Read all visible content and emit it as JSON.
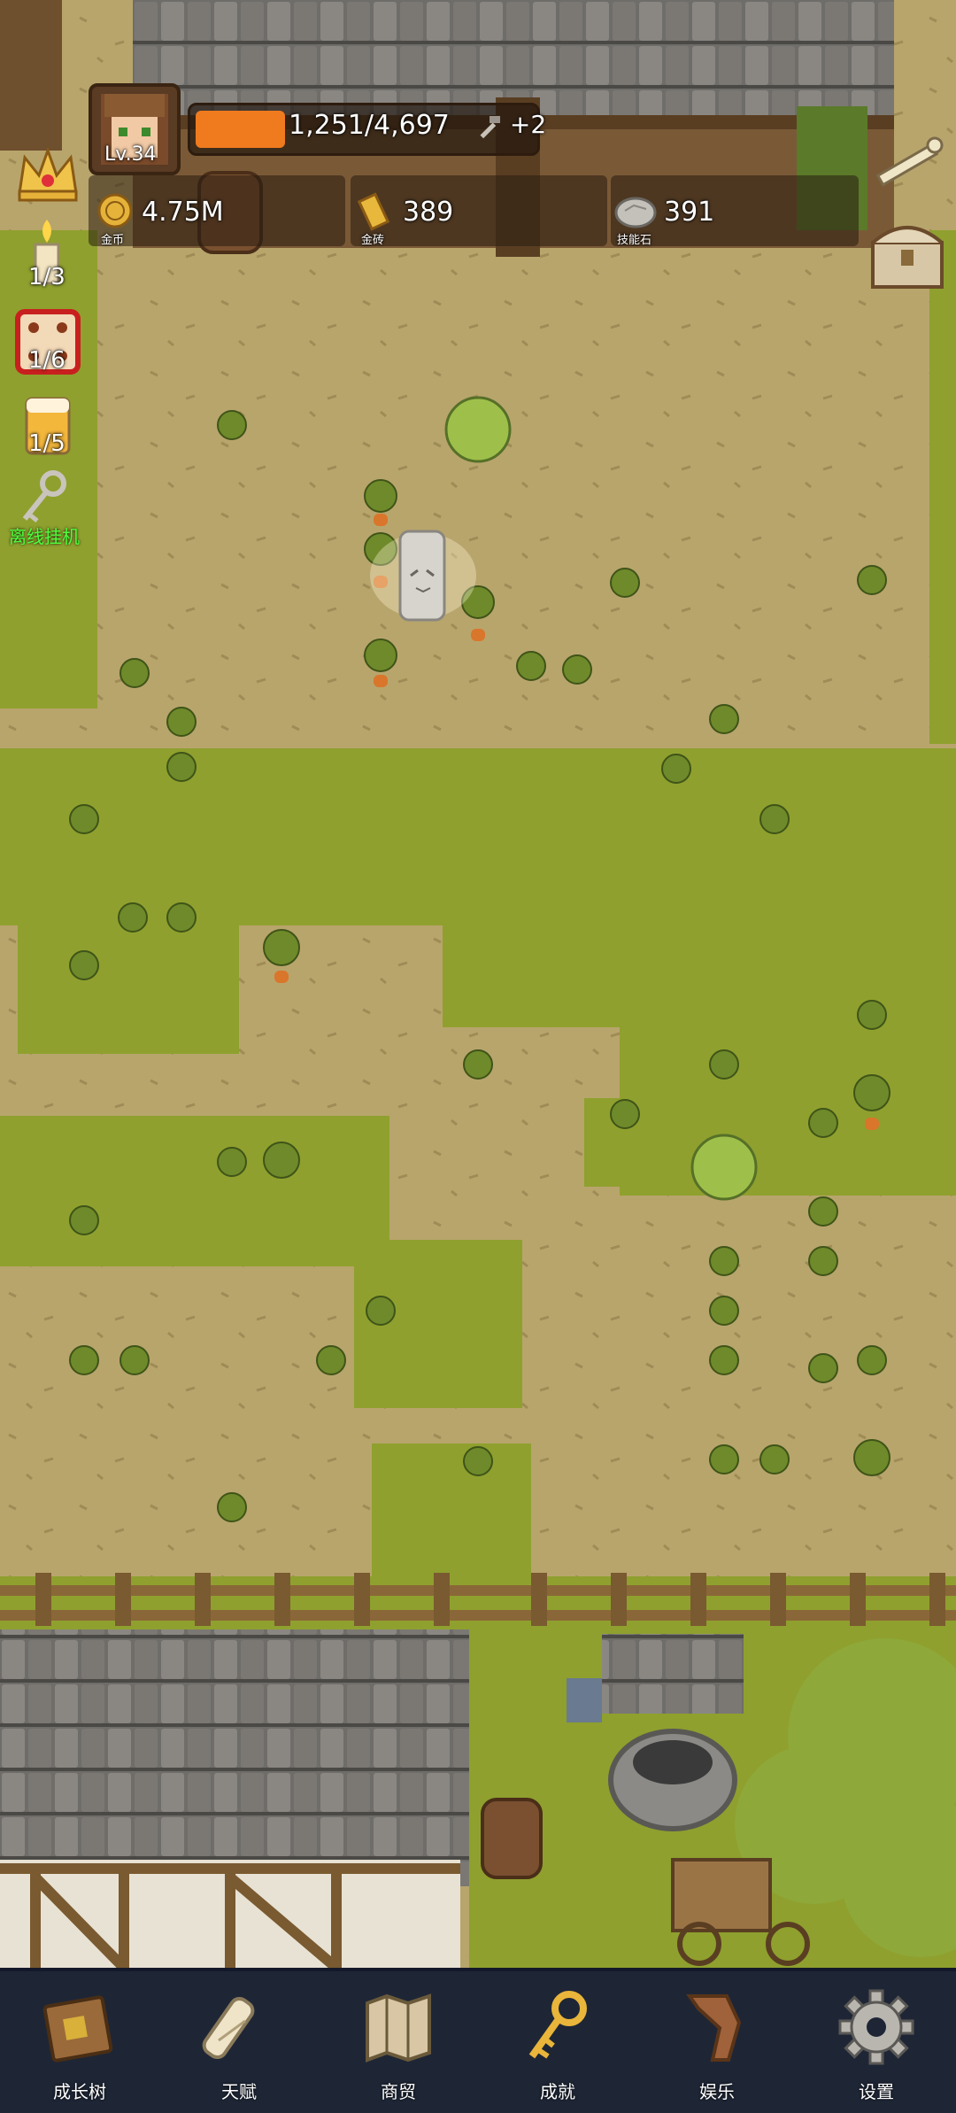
{
  "player": {
    "level": "Lv.34",
    "xp_text": "1,251/4,697",
    "xp_fraction": 0.266,
    "hammer_bonus": "+2"
  },
  "resources": {
    "gold": {
      "value": "4.75M",
      "label": "金币"
    },
    "gold_bar": {
      "value": "389",
      "label": "金砖"
    },
    "skill_stone": {
      "value": "391",
      "label": "技能石"
    }
  },
  "side": {
    "candle_count": "1/3",
    "dice_count": "1/6",
    "beer_count": "1/5",
    "afk_label": "离线挂机"
  },
  "nav": [
    {
      "label": "成长树",
      "icon": "book-icon"
    },
    {
      "label": "天赋",
      "icon": "scroll-icon"
    },
    {
      "label": "商贸",
      "icon": "map-icon"
    },
    {
      "label": "成就",
      "icon": "key-icon"
    },
    {
      "label": "娱乐",
      "icon": "ribbon-icon"
    },
    {
      "label": "设置",
      "icon": "gear-icon"
    }
  ],
  "colors": {
    "xp_fill": "#f07a1e",
    "afk_text": "#4dff3c",
    "nav_bg": "#1e2636"
  }
}
